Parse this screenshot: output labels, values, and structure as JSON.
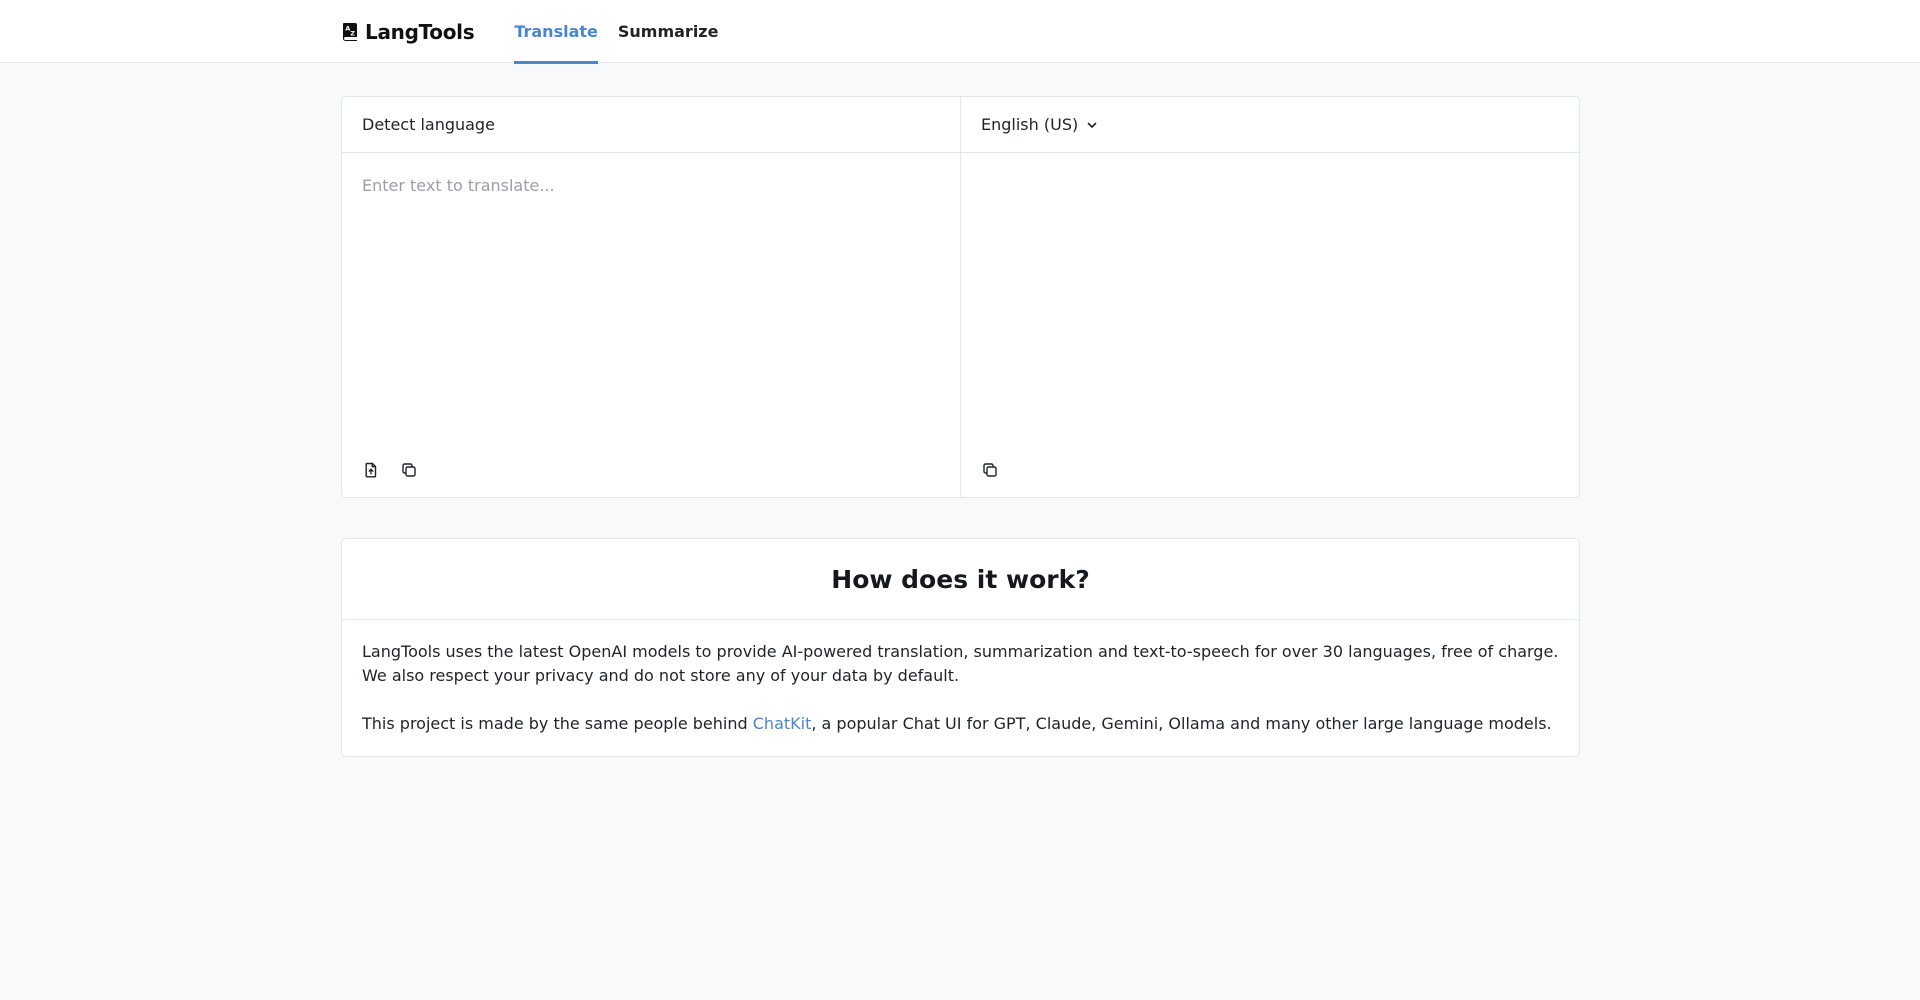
{
  "header": {
    "brand": "LangTools",
    "brand_icon": "translate-icon",
    "tabs": [
      {
        "label": "Translate",
        "active": true
      },
      {
        "label": "Summarize",
        "active": false
      }
    ]
  },
  "translator": {
    "source": {
      "language_label": "Detect language",
      "placeholder": "Enter text to translate...",
      "value": "",
      "tools": [
        "upload-file-icon",
        "copy-icon"
      ]
    },
    "target": {
      "language_label": "English (US)",
      "language_icon": "chevron-down-icon",
      "value": "",
      "tools": [
        "copy-icon"
      ]
    }
  },
  "info": {
    "title": "How does it work?",
    "paragraph1": "LangTools uses the latest OpenAI models to provide AI-powered translation, summarization and text-to-speech for over 30 languages, free of charge. We also respect your privacy and do not store any of your data by default.",
    "paragraph2_before": "This project is made by the same people behind ",
    "paragraph2_link": "ChatKit",
    "paragraph2_after": ", a popular Chat UI for GPT, Claude, Gemini, Ollama and many other large language models."
  },
  "colors": {
    "accent": "#4a86cf",
    "background": "#f8f9fa",
    "border": "#e3e6ea"
  }
}
